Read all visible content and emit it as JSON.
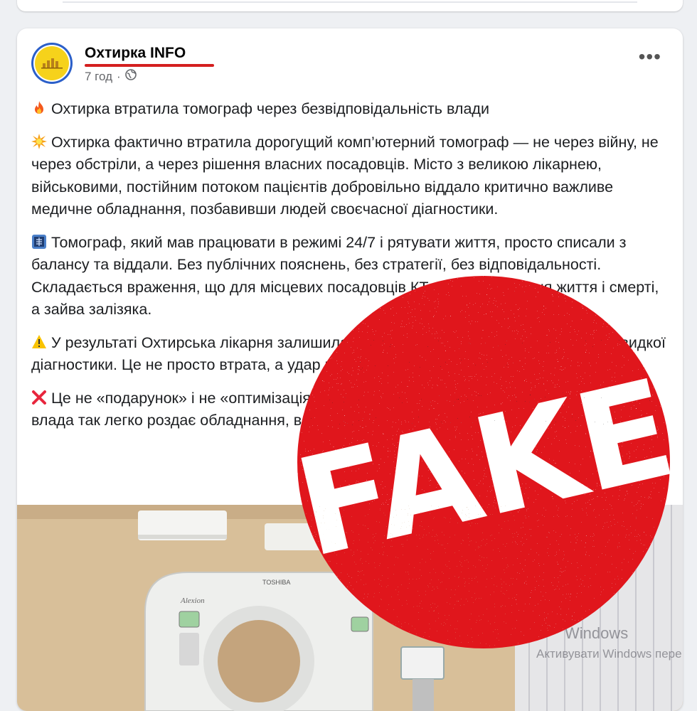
{
  "post": {
    "page_name": "Охтирка INFO",
    "time": "7 год",
    "visibility_dot": "·",
    "more_label": "•••",
    "paragraphs": [
      {
        "icon": "fire-icon",
        "text": "Охтирка втратила томограф через безвідповідальність влади"
      },
      {
        "icon": "collision-icon",
        "text": "Охтирка фактично втратила дорогущий комп’ютерний томограф — не через війну, не через обстріли, а через рішення власних посадовців. Місто з великою лікарнею, військовими, постійним потоком пацієнтів добровільно віддало критично важливе медичне обладнання, позбавивши людей своєчасної діагностики."
      },
      {
        "icon": "xray-icon",
        "text": "Томограф, який мав працювати в режимі 24/7 і рятувати життя, просто списали з балансу та віддали. Без публічних пояснень, без стратегії, без відповідальності. Складається враження, що для місцевих посадовців КТ — це не питання життя і смерті, а зайва залізяка."
      },
      {
        "icon": "warning-icon",
        "text": "У результаті Охтирська лікарня залишилась без томографа, а пацієнти — без швидкої діагностики. Це не просто втрата, а удар по медицині міста й чергове"
      },
      {
        "icon": "cross-mark-icon",
        "text": "Це не «подарунок» і не «оптимізація». Це рішення, за яке мають відповісти. Бо коли влада так легко роздає обладнання, вона так само легко розкидатиметься людьми"
      }
    ]
  },
  "stamp": {
    "text": "FAKE",
    "color": "#e0191f"
  },
  "photo": {
    "brand_label": "TOSHIBA",
    "model_label": "Alexion",
    "windows_watermark_1": "Windows",
    "windows_watermark_2": "Активувати Windows  пере"
  }
}
